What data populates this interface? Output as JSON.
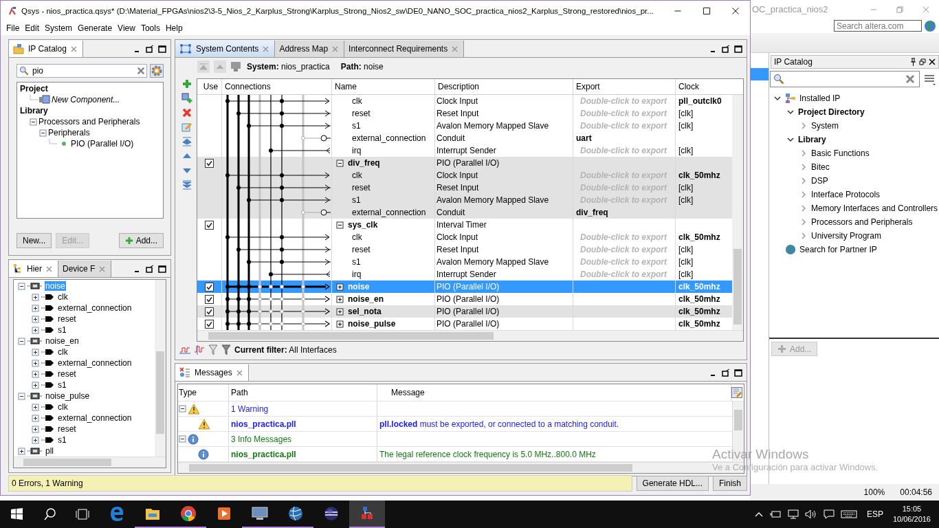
{
  "background_window": {
    "title": "OC_practica_nios2",
    "search": {
      "placeholder": "Search altera.com"
    },
    "ip_catalog": {
      "title": "IP Catalog",
      "tree": [
        {
          "label": "Installed IP",
          "kind": "root",
          "expanded": true,
          "children": [
            {
              "label": "Project Directory",
              "kind": "group",
              "expanded": true,
              "children": [
                {
                  "label": "System",
                  "kind": "item",
                  "expanded": false
                }
              ]
            },
            {
              "label": "Library",
              "kind": "group",
              "expanded": true,
              "children": [
                {
                  "label": "Basic Functions",
                  "kind": "item",
                  "expanded": false
                },
                {
                  "label": "Bitec",
                  "kind": "item",
                  "expanded": false
                },
                {
                  "label": "DSP",
                  "kind": "item",
                  "expanded": false
                },
                {
                  "label": "Interface Protocols",
                  "kind": "item",
                  "expanded": false
                },
                {
                  "label": "Memory Interfaces and Controllers",
                  "kind": "item",
                  "expanded": false
                },
                {
                  "label": "Processors and Peripherals",
                  "kind": "item",
                  "expanded": false
                },
                {
                  "label": "University Program",
                  "kind": "item",
                  "expanded": false
                }
              ]
            }
          ]
        },
        {
          "label": "Search for Partner IP",
          "kind": "link"
        }
      ],
      "add_button": {
        "label": "Add...",
        "disabled": true
      }
    },
    "status": [
      "100%",
      "00:04:56"
    ]
  },
  "window": {
    "title": "Qsys - nios_practica.qsys* (D:\\Material_FPGAs\\nios2\\3-5_Nios_2_Karplus_Strong\\Karplus_Strong_Nios2_sw\\DE0_NANO_SOC_practica_nios2_Karplus_Strong_restored\\nios_pr..."
  },
  "menu": [
    "File",
    "Edit",
    "System",
    "Generate",
    "View",
    "Tools",
    "Help"
  ],
  "ip_catalog": {
    "tab": "IP Catalog",
    "search": "pio",
    "tree": [
      {
        "label": "Project",
        "kind": "heading",
        "children": [
          {
            "label": "New Component...",
            "kind": "component"
          }
        ]
      },
      {
        "label": "Library",
        "kind": "heading",
        "children": [
          {
            "label": "Processors and Peripherals",
            "kind": "folder",
            "expanded": true,
            "children": [
              {
                "label": "Peripherals",
                "kind": "folder",
                "expanded": true,
                "children": [
                  {
                    "label": "PIO (Parallel I/O)",
                    "kind": "ip"
                  }
                ]
              }
            ]
          }
        ]
      }
    ],
    "buttons": [
      {
        "label": "New...",
        "disabled": false
      },
      {
        "label": "Edit...",
        "disabled": true
      },
      {
        "label": "Add...",
        "disabled": false
      }
    ]
  },
  "hierarchy": {
    "tabs": [
      {
        "label": "Hier",
        "selected": true
      },
      {
        "label": "Device F",
        "selected": false
      }
    ],
    "tree": [
      {
        "label": "noise",
        "kind": "module",
        "expanded": true,
        "selected": true,
        "children": [
          {
            "label": "clk",
            "kind": "interface",
            "expanded": false,
            "selected": false
          },
          {
            "label": "external_connection",
            "kind": "interface",
            "expanded": false,
            "selected": false
          },
          {
            "label": "reset",
            "kind": "interface",
            "expanded": false,
            "selected": false
          },
          {
            "label": "s1",
            "kind": "interface",
            "expanded": false,
            "selected": false
          }
        ]
      },
      {
        "label": "noise_en",
        "kind": "module",
        "expanded": true,
        "selected": false,
        "children": [
          {
            "label": "clk",
            "kind": "interface",
            "expanded": false,
            "selected": false
          },
          {
            "label": "external_connection",
            "kind": "interface",
            "expanded": false,
            "selected": false
          },
          {
            "label": "reset",
            "kind": "interface",
            "expanded": false,
            "selected": false
          },
          {
            "label": "s1",
            "kind": "interface",
            "expanded": false,
            "selected": false
          }
        ]
      },
      {
        "label": "noise_pulse",
        "kind": "module",
        "expanded": true,
        "selected": false,
        "children": [
          {
            "label": "clk",
            "kind": "interface",
            "expanded": false,
            "selected": false
          },
          {
            "label": "external_connection",
            "kind": "interface",
            "expanded": false,
            "selected": false
          },
          {
            "label": "reset",
            "kind": "interface",
            "expanded": false,
            "selected": false
          },
          {
            "label": "s1",
            "kind": "interface",
            "expanded": false,
            "selected": false
          }
        ]
      },
      {
        "label": "pll",
        "kind": "module",
        "expanded": false,
        "selected": false
      }
    ]
  },
  "system_contents": {
    "tabs": [
      {
        "label": "System Contents",
        "selected": true
      },
      {
        "label": "Address Map",
        "selected": false
      },
      {
        "label": "Interconnect Requirements",
        "selected": false
      }
    ],
    "system": "**System:** nios_practica",
    "path": "**Path:** noise",
    "columns": [
      "Use",
      "Connections",
      "Name",
      "Description",
      "Export",
      "Clock"
    ],
    "rows": [
      {
        "kind": "sink",
        "name": "clk",
        "description": "Clock Input",
        "export": "Double-click to export",
        "exported": false,
        "clock": "pll_outclk0",
        "clock_bold": true,
        "shaded": false
      },
      {
        "kind": "sink",
        "name": "reset",
        "description": "Reset Input",
        "export": "Double-click to export",
        "exported": false,
        "clock": "[clk]",
        "clock_bold": false,
        "shaded": false
      },
      {
        "kind": "sink",
        "name": "s1",
        "description": "Avalon Memory Mapped Slave",
        "export": "Double-click to export",
        "exported": false,
        "clock": "[clk]",
        "clock_bold": false,
        "shaded": false
      },
      {
        "kind": "conduit",
        "name": "external_connection",
        "description": "Conduit",
        "export": "uart",
        "exported": true,
        "shaded": false
      },
      {
        "kind": "source",
        "name": "irq",
        "description": "Interrupt Sender",
        "export": "Double-click to export",
        "exported": false,
        "clock": "[clk]",
        "clock_bold": false,
        "shaded": false
      },
      {
        "kind": "module",
        "name": "div_freq",
        "description": "PIO (Parallel I/O)",
        "checked": true,
        "expanded": true,
        "selected": false,
        "shaded": true
      },
      {
        "kind": "sink",
        "name": "clk",
        "description": "Clock Input",
        "export": "Double-click to export",
        "exported": false,
        "clock": "clk_50mhz",
        "clock_bold": true,
        "shaded": true
      },
      {
        "kind": "sink",
        "name": "reset",
        "description": "Reset Input",
        "export": "Double-click to export",
        "exported": false,
        "clock": "[clk]",
        "clock_bold": false,
        "shaded": true
      },
      {
        "kind": "sink",
        "name": "s1",
        "description": "Avalon Memory Mapped Slave",
        "export": "Double-click to export",
        "exported": false,
        "clock": "[clk]",
        "clock_bold": false,
        "shaded": true
      },
      {
        "kind": "conduit",
        "name": "external_connection",
        "description": "Conduit",
        "export": "div_freq",
        "exported": true,
        "shaded": true
      },
      {
        "kind": "module",
        "name": "sys_clk",
        "description": "Interval Timer",
        "checked": true,
        "expanded": true,
        "selected": false,
        "shaded": false
      },
      {
        "kind": "sink",
        "name": "clk",
        "description": "Clock Input",
        "export": "Double-click to export",
        "exported": false,
        "clock": "clk_50mhz",
        "clock_bold": true,
        "shaded": false
      },
      {
        "kind": "sink",
        "name": "reset",
        "description": "Reset Input",
        "export": "Double-click to export",
        "exported": false,
        "clock": "[clk]",
        "clock_bold": false,
        "shaded": false
      },
      {
        "kind": "sink",
        "name": "s1",
        "description": "Avalon Memory Mapped Slave",
        "export": "Double-click to export",
        "exported": false,
        "clock": "[clk]",
        "clock_bold": false,
        "shaded": false
      },
      {
        "kind": "source",
        "name": "irq",
        "description": "Interrupt Sender",
        "export": "Double-click to export",
        "exported": false,
        "clock": "[clk]",
        "clock_bold": false,
        "shaded": false
      },
      {
        "kind": "module",
        "name": "noise",
        "description": "PIO (Parallel I/O)",
        "checked": true,
        "expanded": false,
        "selected": true,
        "clock": "clk_50mhz",
        "clock_bold": true,
        "shaded": false
      },
      {
        "kind": "module",
        "name": "noise_en",
        "description": "PIO (Parallel I/O)",
        "checked": true,
        "expanded": false,
        "selected": false,
        "clock": "clk_50mhz",
        "clock_bold": true,
        "shaded": false
      },
      {
        "kind": "module",
        "name": "sel_nota",
        "description": "PIO (Parallel I/O)",
        "checked": true,
        "expanded": false,
        "selected": false,
        "clock": "clk_50mhz",
        "clock_bold": true,
        "shaded": true
      },
      {
        "kind": "module",
        "name": "noise_pulse",
        "description": "PIO (Parallel I/O)",
        "checked": true,
        "expanded": false,
        "selected": false,
        "clock": "clk_50mhz",
        "clock_bold": true,
        "shaded": false
      }
    ],
    "filter": "**Current filter:** All Interfaces"
  },
  "messages": {
    "tab": "Messages",
    "columns": [
      "Type",
      "Path",
      "Message"
    ],
    "rows": [
      {
        "kind": "warning_group",
        "expanded": true,
        "path": "1 Warning"
      },
      {
        "kind": "warning",
        "path": "nios_practica.pll",
        "message": "**pll.locked** must be exported, or connected to a matching conduit."
      },
      {
        "kind": "info_group",
        "expanded": true,
        "path": "3 Info Messages"
      },
      {
        "kind": "info",
        "path": "nios_practica.pll",
        "message": "The legal reference clock frequency is 5.0 MHz..800.0 MHz"
      }
    ]
  },
  "status": {
    "text": "0 Errors, 1 Warning",
    "buttons": [
      "Generate HDL...",
      "Finish"
    ]
  },
  "activation": [
    "Activar Windows",
    "Ve a Configuración para activar Windows."
  ],
  "taskbar": {
    "apps": [
      {
        "kind": "edge",
        "running": false,
        "active": false
      },
      {
        "kind": "folder",
        "running": true,
        "active": false
      },
      {
        "kind": "chrome",
        "running": true,
        "active": false
      },
      {
        "kind": "player",
        "running": false,
        "active": false
      },
      {
        "kind": "monitor",
        "running": true,
        "active": false
      },
      {
        "kind": "globe",
        "running": true,
        "active": false
      },
      {
        "kind": "sphere",
        "running": false,
        "active": false
      },
      {
        "kind": "chip",
        "running": true,
        "active": true
      }
    ],
    "language": "ESP",
    "time": "15:05",
    "date": "10/06/2016"
  }
}
